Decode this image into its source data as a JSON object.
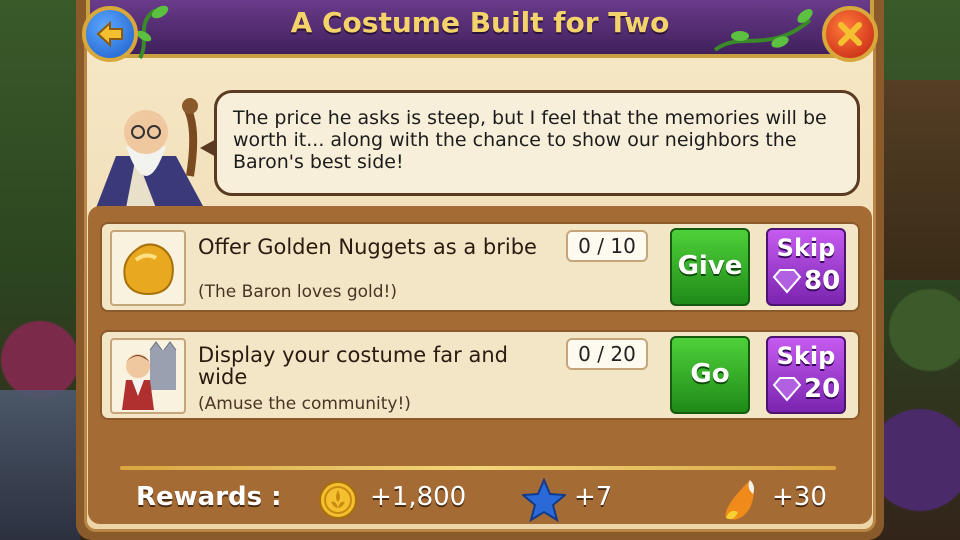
{
  "title": "A Costume Built for Two",
  "speech": "The price he asks is steep, but I feel that the memories will be worth it... along with the chance to show our neighbors the Baron's best side!",
  "tasks": [
    {
      "title": "Offer Golden Nuggets as a bribe",
      "hint": "(The Baron loves gold!)",
      "progress": "0 / 10",
      "action_label": "Give",
      "skip_label": "Skip",
      "skip_cost": "80",
      "icon": "golden-nugget-icon"
    },
    {
      "title": "Display your costume far and wide",
      "hint": "(Amuse the community!)",
      "progress": "0 / 20",
      "action_label": "Go",
      "skip_label": "Skip",
      "skip_cost": "20",
      "icon": "costumed-character-icon"
    }
  ],
  "rewards": {
    "label": "Rewards :",
    "coins": "+1,800",
    "stars": "+7",
    "candy": "+30"
  },
  "colors": {
    "title_text": "#f4d36a",
    "banner": "#40205c",
    "green_button": "#1f8a18",
    "skip_button": "#7a24b0"
  }
}
